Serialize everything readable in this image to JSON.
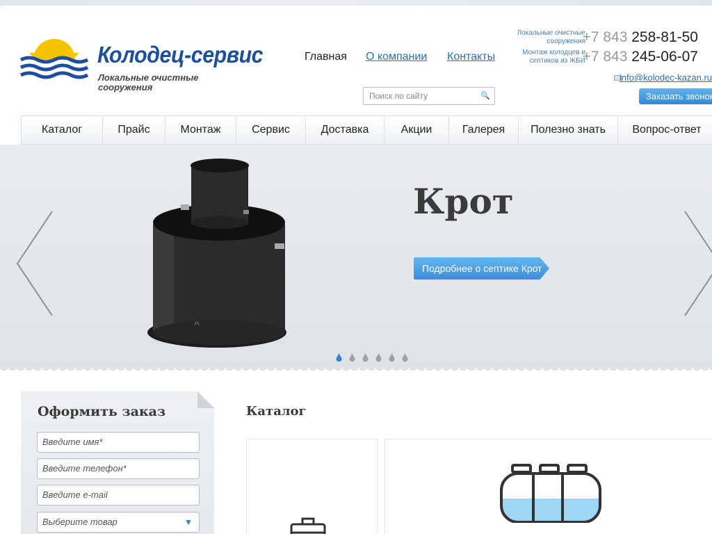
{
  "brand": {
    "name": "Колодец-сервис",
    "tagline": "Локальные очистные сооружения"
  },
  "topnav": {
    "home": "Главная",
    "about": "О компании",
    "contacts": "Контакты"
  },
  "search": {
    "placeholder": "Поиск по сайту"
  },
  "contacts": {
    "phone1": {
      "caption": "Локальные очистные сооружения",
      "code": "+7 843",
      "number": "258-81-50"
    },
    "phone2": {
      "caption": "Монтаж колодцев и септиков из ЖБИ",
      "code": "+7 843",
      "number": "245-06-07"
    },
    "email": "info@kolodec-kazan.ru",
    "callback_label": "Заказать звонок"
  },
  "menu": {
    "items": [
      "Каталог",
      "Прайс",
      "Монтаж",
      "Сервис",
      "Доставка",
      "Акции",
      "Галерея",
      "Полезно знать",
      "Вопрос-ответ"
    ]
  },
  "slider": {
    "title": "Крот",
    "button_label": "Подробнее о септике Крот",
    "slide_count": 6,
    "active_slide": 1
  },
  "order_form": {
    "title": "Оформить заказ",
    "name_placeholder": "Введите имя*",
    "phone_placeholder": "Введите телефон*",
    "email_placeholder": "Введите e-mail",
    "product_select": "Выберите товар"
  },
  "catalog": {
    "title": "Каталог"
  },
  "colors": {
    "brand_blue": "#1e4f9e",
    "link_blue": "#2e6fb5",
    "button_blue": "#3b8ddb",
    "logo_yellow": "#f5c400"
  }
}
